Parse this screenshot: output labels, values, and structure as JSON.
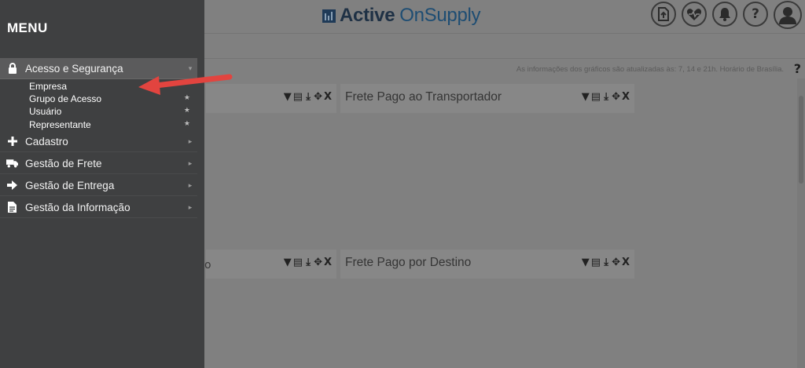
{
  "header": {
    "logo_bold": "Active",
    "logo_light": "OnSupply",
    "icons": [
      "upload-doc-icon",
      "health-heart-icon",
      "bell-icon",
      "help-icon",
      "user-avatar-icon"
    ],
    "help_label": "?"
  },
  "info": {
    "update_note": "As informações dos gráficos são atualizadas às: 7, 14 e 21h. Horário de Brasília.",
    "help_label": "?"
  },
  "panels": [
    {
      "title": "",
      "tools": [
        "filter",
        "print",
        "download",
        "move",
        "X"
      ]
    },
    {
      "title": "Frete Pago ao Transportador",
      "tools": [
        "filter",
        "print",
        "download",
        "move",
        "X"
      ]
    },
    {
      "title": "",
      "tools": [
        "filter",
        "print",
        "download",
        "move",
        "X"
      ]
    },
    {
      "title": "Frete Pago por Destino",
      "tools": [
        "filter",
        "print",
        "download",
        "move",
        "X"
      ]
    }
  ],
  "panel_close_label": "X",
  "panel_tail": "o",
  "menu": {
    "title": "MENU",
    "items": [
      {
        "label": "Acesso e Segurança",
        "icon": "lock-icon",
        "expanded": true
      },
      {
        "label": "Cadastro",
        "icon": "plus-icon"
      },
      {
        "label": "Gestão de Frete",
        "icon": "truck-icon"
      },
      {
        "label": "Gestão de Entrega",
        "icon": "arrow-right-icon"
      },
      {
        "label": "Gestão da Informação",
        "icon": "document-icon"
      }
    ],
    "subitems": [
      {
        "label": "Empresa",
        "starred": false
      },
      {
        "label": "Grupo de Acesso",
        "starred": true
      },
      {
        "label": "Usuário",
        "starred": true
      },
      {
        "label": "Representante",
        "starred": true
      }
    ]
  },
  "colors": {
    "menu_bg": "#3f4041",
    "overlay_bg": "#808080",
    "arrow": "#e2443f",
    "logo_dark": "#1f3145",
    "logo_blue": "#1e4d73"
  }
}
